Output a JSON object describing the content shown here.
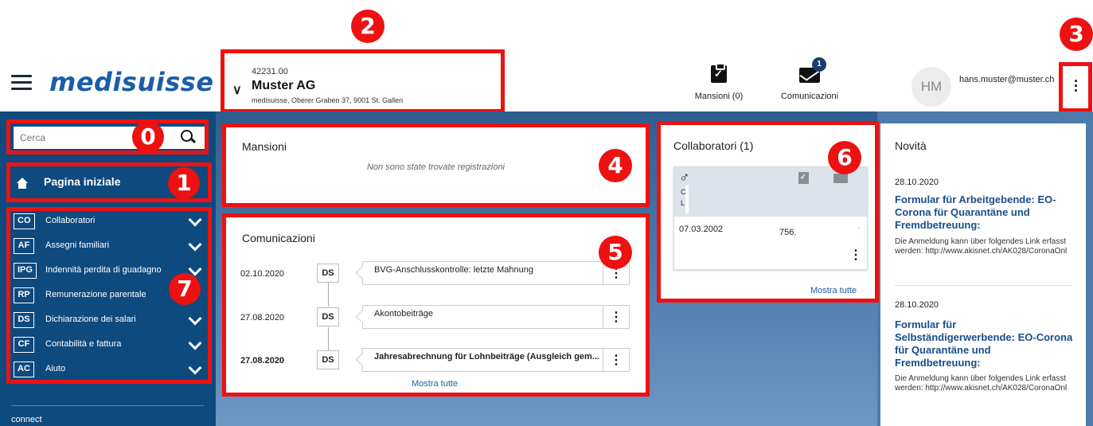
{
  "header": {
    "logo": "medisuisse",
    "company": {
      "id": "42231.00",
      "name": "Muster AG",
      "address": "medisuisse, Oberer Graben 37, 9001 St. Gallen"
    },
    "tasks_label": "Mansioni (0)",
    "messages_label": "Comunicazioni",
    "messages_badge": "1",
    "avatar_initials": "HM",
    "user_email": "hans.muster@muster.ch"
  },
  "markers": {
    "search": "0",
    "home": "1",
    "company": "2",
    "user_menu": "3",
    "tasks": "4",
    "communications": "5",
    "employees": "6",
    "menu": "7"
  },
  "sidebar": {
    "search_placeholder": "Cerca",
    "home_label": "Pagina iniziale",
    "items": [
      {
        "abbr": "CO",
        "label": "Collaboratori"
      },
      {
        "abbr": "AF",
        "label": "Assegni familiari"
      },
      {
        "abbr": "IPG",
        "label": "Indennità perdita di guadagno"
      },
      {
        "abbr": "RP",
        "label": "Remunerazione parentale"
      },
      {
        "abbr": "DS",
        "label": "Dichiarazione dei salari"
      },
      {
        "abbr": "CF",
        "label": "Contabilità e fattura"
      },
      {
        "abbr": "AC",
        "label": "Aiuto"
      }
    ],
    "footer": "connect"
  },
  "tasks": {
    "title": "Mansioni",
    "empty": "Non sono state trovate registrazioni"
  },
  "communications": {
    "title": "Comunicazioni",
    "rows": [
      {
        "date": "02.10.2020",
        "tag": "DS",
        "subject": "BVG-Anschlusskontrolle: letzte Mahnung",
        "unread": false
      },
      {
        "date": "27.08.2020",
        "tag": "DS",
        "subject": "Akontobeiträge",
        "unread": false
      },
      {
        "date": "27.08.2020",
        "tag": "DS",
        "subject": "Jahresabrechnung für Lohnbeiträge (Ausgleich gem...",
        "unread": true
      }
    ],
    "show_all": "Mostra tutte"
  },
  "employees": {
    "title": "Collaboratori (1)",
    "card": {
      "gender": "♂",
      "name": "C",
      "sub": "L",
      "birth_date": "07.03.2002",
      "ahv": "756.",
      "extra": "·"
    },
    "show_all": "Mostra tutte"
  },
  "news": {
    "title": "Novità",
    "items": [
      {
        "date": "28.10.2020",
        "headline": "Formular für Arbeitgebende: EO-Corona für Quarantäne und Fremdbetreuung:",
        "body": "Die Anmeldung kann über folgendes Link erfasst werden: http://www.akisnet.ch/AK028/CoronaOnl"
      },
      {
        "date": "28.10.2020",
        "headline": "Formular für Selbständigerwerbende: EO-Corona für Quarantäne und Fremdbetreuung:",
        "body": "Die Anmeldung kann über folgendes Link erfasst werden: http://www.akisnet.ch/AK028/CoronaOnl"
      }
    ]
  },
  "colors": {
    "brand": "#1a5ea8",
    "sidebar": "#0e4a7e",
    "annotation": "#ee1111"
  }
}
